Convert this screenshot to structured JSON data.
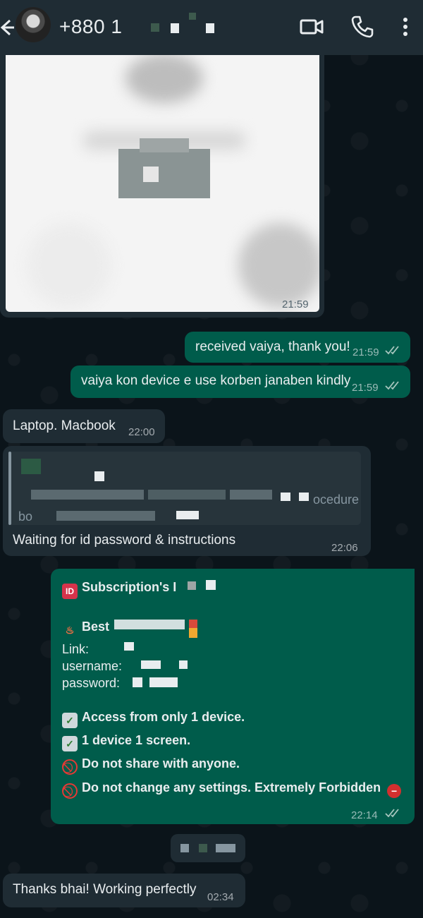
{
  "header": {
    "contact_name": "+880 1",
    "icons": [
      "back-arrow-icon",
      "video-call-icon",
      "voice-call-icon",
      "more-options-icon"
    ]
  },
  "messages": {
    "image_msg": {
      "time": "21:59"
    },
    "received_thanks": {
      "text": "received vaiya, thank you!",
      "time": "21:59"
    },
    "device_question": {
      "text": "vaiya kon device e use korben janaben kindly",
      "time": "21:59"
    },
    "laptop_reply": {
      "text": "Laptop. Macbook",
      "time": "22:00"
    },
    "waiting_reply": {
      "quote_fragment_1": "ocedure",
      "quote_fragment_2": "bo",
      "text": "Waiting for id password & instructions",
      "time": "22:06"
    },
    "subscription": {
      "title": "Subscription's I",
      "best": "Best",
      "link_label": "Link:",
      "username_label": "username:",
      "password_label": "password:",
      "rules": [
        "Access from only 1 device.",
        "1 device 1 screen.",
        "Do not share with anyone.",
        "Do not change any settings. Extremely Forbidden"
      ],
      "time": "22:14"
    },
    "thanks_msg": {
      "text": "Thanks bhai! Working perfectly",
      "time": "02:34"
    }
  },
  "colors": {
    "background": "#0b141a",
    "incoming_bubble": "#1f2c34",
    "outgoing_bubble": "#005c4b",
    "header": "#1f2c34"
  }
}
